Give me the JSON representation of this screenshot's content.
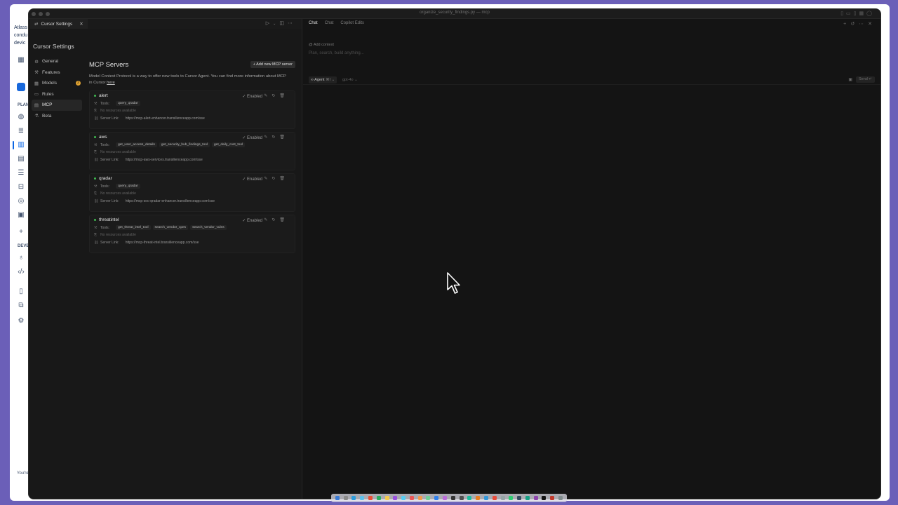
{
  "background_app": {
    "banner_lines": [
      "Atlass",
      "condu",
      "devic"
    ],
    "section_planning": "PLAN",
    "section_dev": "DEVE",
    "footer": "You're"
  },
  "window": {
    "title": "organize_security_findings.py — mcp"
  },
  "editor_tab": {
    "label": "Cursor Settings"
  },
  "settings": {
    "heading": "Cursor Settings",
    "nav": [
      {
        "label": "General",
        "icon": "gear-icon"
      },
      {
        "label": "Features",
        "icon": "sliders-icon"
      },
      {
        "label": "Models",
        "icon": "cube-icon",
        "badge": "2"
      },
      {
        "label": "Rules",
        "icon": "book-icon"
      },
      {
        "label": "MCP",
        "icon": "server-icon",
        "active": true
      },
      {
        "label": "Beta",
        "icon": "flask-icon"
      }
    ]
  },
  "mcp": {
    "title": "MCP Servers",
    "add_button": "+ Add new MCP server",
    "description": "Model Context Protocol is a way to offer new tools to Cursor Agent. You can find more information about MCP in Cursor",
    "description_link": "here",
    "tools_label": "Tools:",
    "server_link_label": "Server Link:",
    "no_resources": "No resources available",
    "status": "✓ Enabled",
    "servers": [
      {
        "name": "alert",
        "tools": [
          "query_qradar"
        ],
        "link": "https://mcp-alert-enhancer.transilienceapp.com/sse"
      },
      {
        "name": "aws",
        "tools": [
          "get_user_access_details",
          "get_security_hub_findings_tool",
          "get_daily_cost_tool"
        ],
        "link": "https://mcp-aws-services.transilienceapp.com/sse"
      },
      {
        "name": "qradar",
        "tools": [
          "query_qradar"
        ],
        "link": "https://mcp-soc-qradar-enhancer.transilienceapp.com/sse"
      },
      {
        "name": "threatintel",
        "tools": [
          "get_threat_intel_tool",
          "search_vendor_cpes",
          "search_vendor_vulns"
        ],
        "link": "https://mcp-threat-intel.transilienceapp.com/sse"
      }
    ]
  },
  "chat": {
    "tabs": [
      "Chat",
      "Chat",
      "Copilot Edits"
    ],
    "add_context": "Add context",
    "input_placeholder": "Plan, search, build anything...",
    "agent_label": "Agent",
    "agent_shortcut": "⌘I",
    "model_label": "gpt-4o",
    "send_label": "Send"
  },
  "colors": {
    "status_green": "#3fb950",
    "badge_orange": "#e2a431",
    "desktop": "#6b5fb8"
  }
}
